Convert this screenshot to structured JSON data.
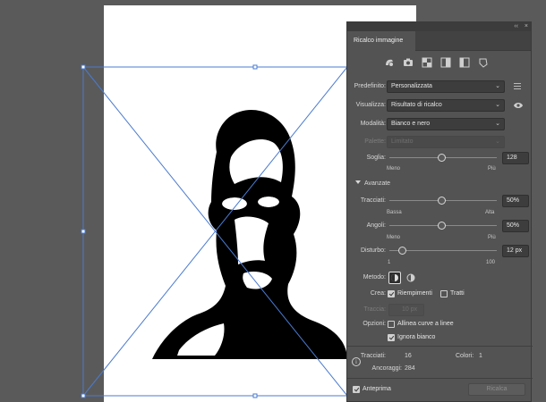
{
  "panel": {
    "tab_title": "Ricalco immagine",
    "collapse_label": "‹‹",
    "close_label": "×",
    "preset": {
      "label": "Predefinito:",
      "value": "Personalizzata"
    },
    "view": {
      "label": "Visualizza:",
      "value": "Risultato di ricalco"
    },
    "mode": {
      "label": "Modalità:",
      "value": "Bianco e nero"
    },
    "palette": {
      "label": "Palette:",
      "value": "Limitato"
    },
    "threshold": {
      "label": "Soglia:",
      "value": "128",
      "level": 128,
      "min_label": "Meno",
      "max_label": "Più"
    },
    "advanced_label": "Avanzate",
    "paths": {
      "label": "Tracciati:",
      "value": "50%",
      "level": 0.5,
      "min_label": "Bassa",
      "max_label": "Alta"
    },
    "corners": {
      "label": "Angoli:",
      "value": "50%",
      "level": 0.5,
      "min_label": "Meno",
      "max_label": "Più"
    },
    "noise": {
      "label": "Disturbo:",
      "value": "12 px",
      "level": 12,
      "min_label": "1",
      "max_label": "100"
    },
    "method_label": "Metodo:",
    "create": {
      "label": "Crea:",
      "fills_label": "Riempimenti",
      "strokes_label": "Tratti"
    },
    "stroke": {
      "label": "Traccia:",
      "value": "10 px"
    },
    "options": {
      "label": "Opzioni:",
      "snap_label": "Allinea curve a linee",
      "ignore_white_label": "Ignora bianco"
    },
    "info": {
      "paths_label": "Tracciati:",
      "paths_value": "16",
      "colors_label": "Colori:",
      "colors_value": "1",
      "anchors_label": "Ancoraggi:",
      "anchors_value": "284"
    },
    "preview_label": "Anteprima",
    "trace_button": "Ricalca"
  },
  "colors": {
    "panel": "#535353",
    "selection": "#4a7bd0",
    "canvas": "#5a5a5a"
  }
}
